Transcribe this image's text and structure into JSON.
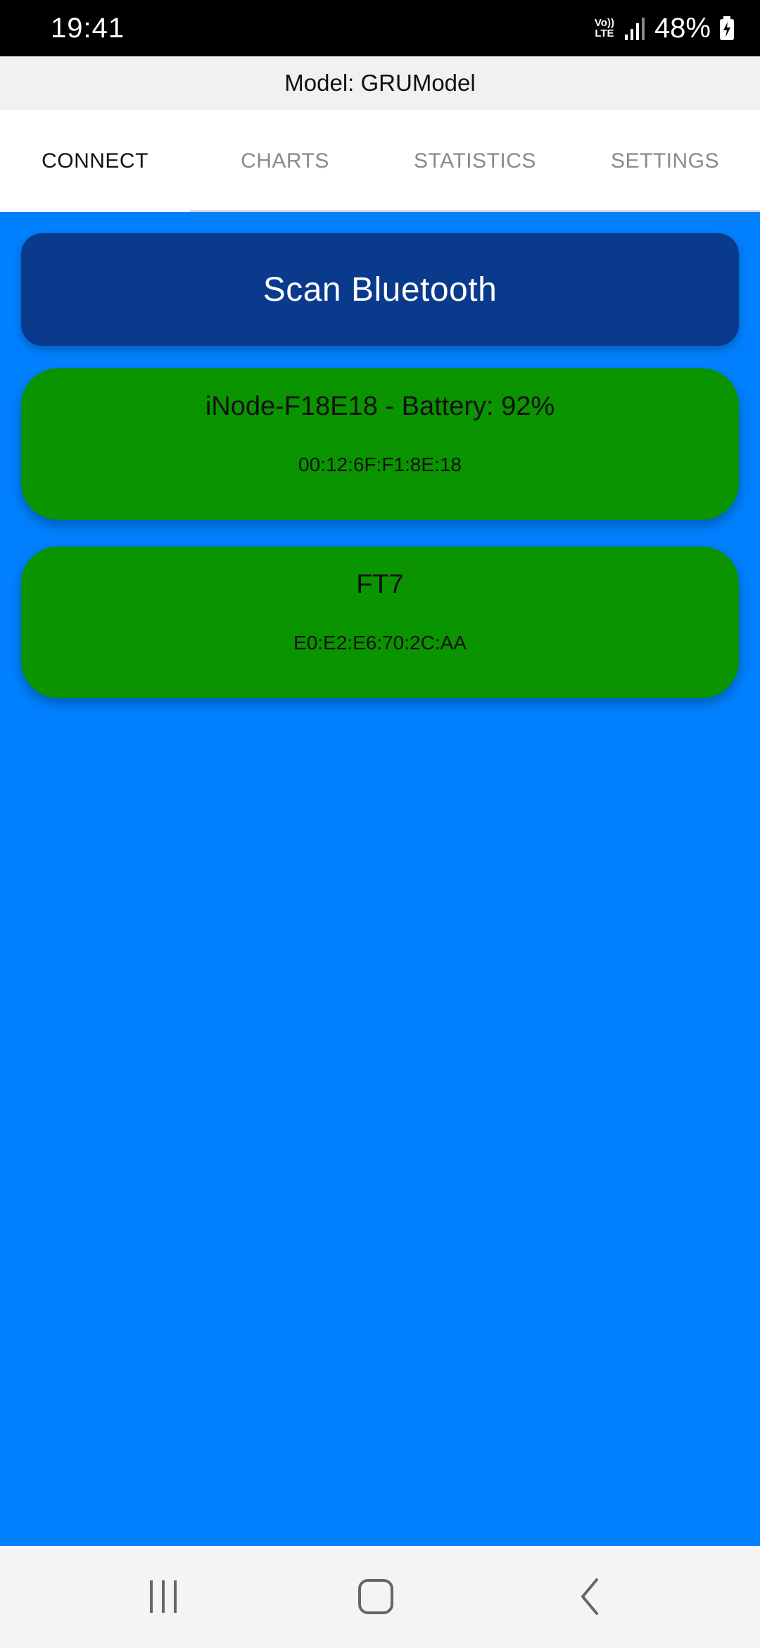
{
  "status_bar": {
    "time": "19:41",
    "volte_top": "Vo))",
    "volte_bottom": "LTE",
    "battery": "48%"
  },
  "header": {
    "title": "Model: GRUModel"
  },
  "tabs": [
    {
      "label": "CONNECT",
      "active": true
    },
    {
      "label": "CHARTS",
      "active": false
    },
    {
      "label": "STATISTICS",
      "active": false
    },
    {
      "label": "SETTINGS",
      "active": false
    }
  ],
  "main": {
    "scan_button_label": "Scan Bluetooth",
    "devices": [
      {
        "name": "iNode-F18E18 - Battery: 92%",
        "mac": "00:12:6F:F1:8E:18"
      },
      {
        "name": "FT7",
        "mac": "E0:E2:E6:70:2C:AA"
      }
    ]
  },
  "nav_bar": {
    "items": [
      "recent-apps-icon",
      "home-icon",
      "back-icon"
    ]
  },
  "colors": {
    "background": "#0080ff",
    "scan_button": "#0a3a8c",
    "device_card": "#0a9400",
    "status_bar": "#000000",
    "title_bar": "#f1f1f1"
  }
}
